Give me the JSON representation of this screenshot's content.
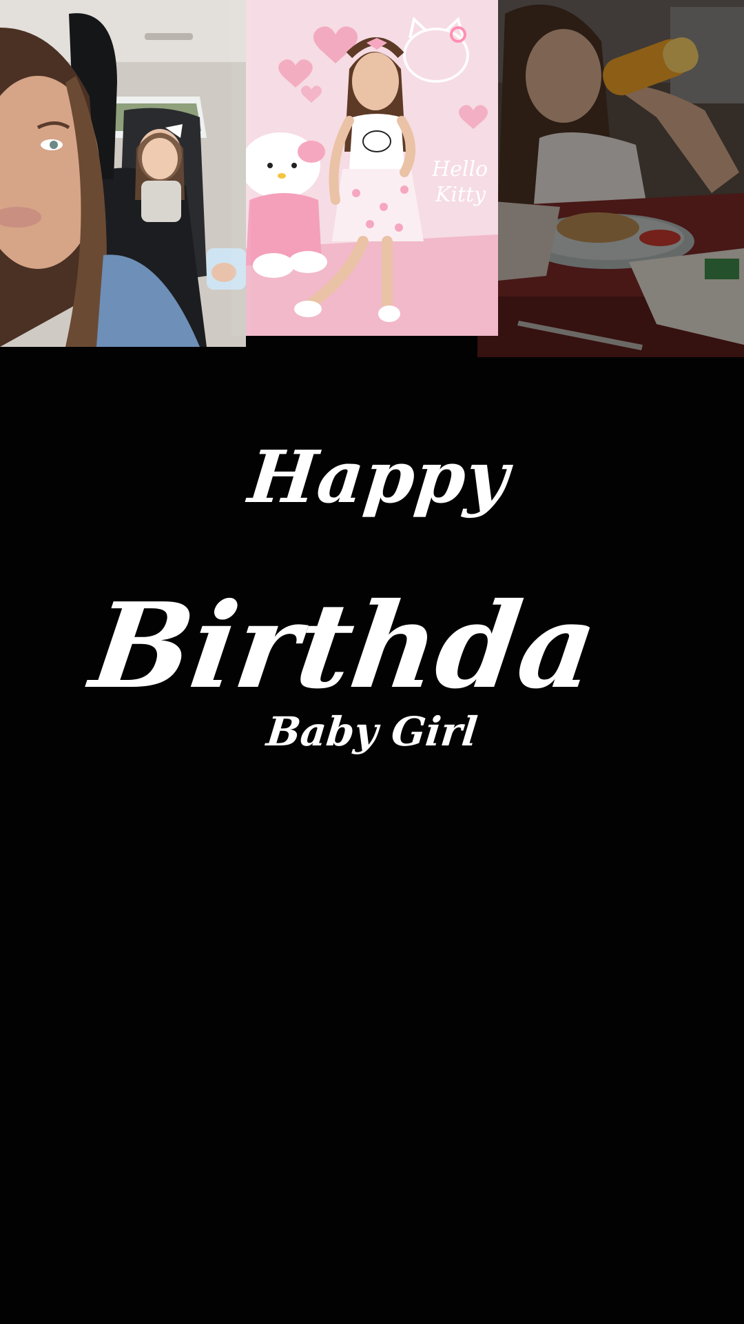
{
  "collage": {
    "photos": [
      {
        "subject": "selfie in car with child in back seat"
      },
      {
        "subject": "girl posing in Hello Kitty outfit with plush and pink backdrop",
        "backdrop_sign": "Hello Kitty"
      },
      {
        "subject": "girl drinking juice at restaurant table"
      }
    ]
  },
  "title": {
    "line1": "Happy",
    "line2": "Birthda",
    "line3": "Baby Girl"
  },
  "colors": {
    "background": "#020203",
    "text": "#ffffff",
    "accent_pink": "#f4c6d4"
  }
}
